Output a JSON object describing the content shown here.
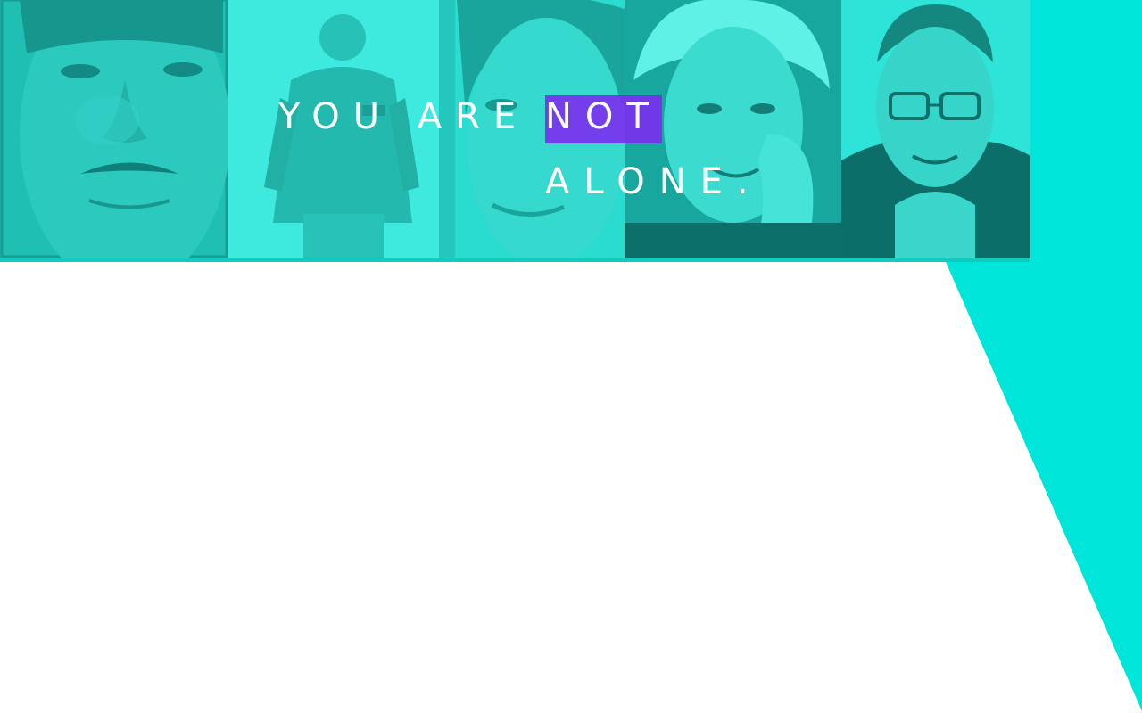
{
  "headline": {
    "line1_plain": "YOU ARE",
    "line1_highlight": "NOT",
    "line2": "ALONE."
  },
  "colors": {
    "accent_cyan": "#00e5d9",
    "tint_cyan": "#26e6da",
    "highlight_purple": "#7b2cf0",
    "text": "#ffffff"
  },
  "portraits": [
    {
      "subject": "man-closeup"
    },
    {
      "subject": "older-man-standing"
    },
    {
      "subject": "woman-closeup"
    },
    {
      "subject": "elderly-woman-hand-on-cheek"
    },
    {
      "subject": "man-with-glasses-hands-clasped"
    }
  ]
}
